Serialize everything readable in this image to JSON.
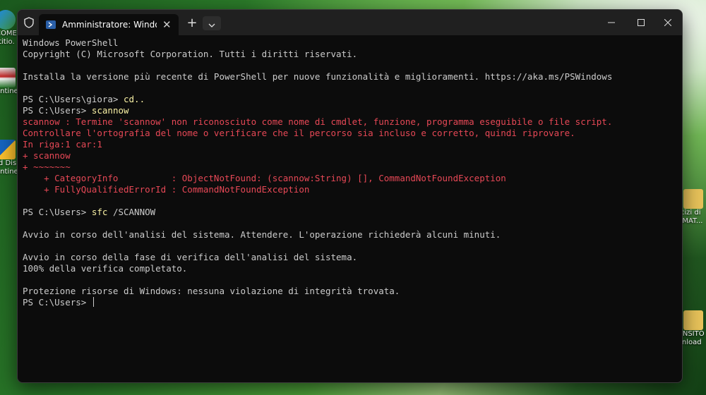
{
  "desktop": {
    "icons": [
      {
        "label": "COME\nrtitio."
      },
      {
        "label": "entine"
      },
      {
        "label": "rd Dis\nentine"
      },
      {
        "label": "rcizi di\nEMAT..."
      },
      {
        "label": "ANSITO\nvnload"
      }
    ]
  },
  "window": {
    "tab_title": "Amministratore: Windows PowerShell",
    "tab_close": "✕",
    "new_tab": "+",
    "dropdown_icon": "chevron-down",
    "minimize": "—",
    "maximize": "☐",
    "close": "✕"
  },
  "console": {
    "lines": [
      {
        "text": "Windows PowerShell",
        "style": "normal"
      },
      {
        "text": "Copyright (C) Microsoft Corporation. Tutti i diritti riservati.",
        "style": "normal"
      },
      {
        "text": "",
        "style": "normal"
      },
      {
        "text": "Installa la versione più recente di PowerShell per nuove funzionalità e miglioramenti. https://aka.ms/PSWindows",
        "style": "normal"
      },
      {
        "text": "",
        "style": "normal"
      },
      {
        "prompt": "PS C:\\Users\\giora> ",
        "command": "cd..",
        "style": "prompt"
      },
      {
        "prompt": "PS C:\\Users> ",
        "command": "scannow",
        "style": "prompt"
      },
      {
        "text": "scannow : Termine 'scannow' non riconosciuto come nome di cmdlet, funzione, programma eseguibile o file script.",
        "style": "error"
      },
      {
        "text": "Controllare l'ortografia del nome o verificare che il percorso sia incluso e corretto, quindi riprovare.",
        "style": "error"
      },
      {
        "text": "In riga:1 car:1",
        "style": "error"
      },
      {
        "text": "+ scannow",
        "style": "error"
      },
      {
        "text": "+ ~~~~~~~",
        "style": "error"
      },
      {
        "text": "    + CategoryInfo          : ObjectNotFound: (scannow:String) [], CommandNotFoundException",
        "style": "error"
      },
      {
        "text": "    + FullyQualifiedErrorId : CommandNotFoundException",
        "style": "error"
      },
      {
        "text": "",
        "style": "normal"
      },
      {
        "prompt": "PS C:\\Users> ",
        "command": "sfc",
        "args": " /SCANNOW",
        "style": "prompt"
      },
      {
        "text": "",
        "style": "normal"
      },
      {
        "text": "Avvio in corso dell'analisi del sistema. Attendere. L'operazione richiederà alcuni minuti.",
        "style": "normal"
      },
      {
        "text": "",
        "style": "normal"
      },
      {
        "text": "Avvio in corso della fase di verifica dell'analisi del sistema.",
        "style": "normal"
      },
      {
        "text": "100% della verifica completato.",
        "style": "normal"
      },
      {
        "text": "",
        "style": "normal"
      },
      {
        "text": "Protezione risorse di Windows: nessuna violazione di integrità trovata.",
        "style": "normal"
      },
      {
        "prompt": "PS C:\\Users> ",
        "command": "",
        "style": "prompt-active"
      }
    ]
  },
  "colors": {
    "error": "#e74856",
    "command": "#f9f1a5",
    "text": "#cccccc",
    "background": "#0c0c0c"
  }
}
